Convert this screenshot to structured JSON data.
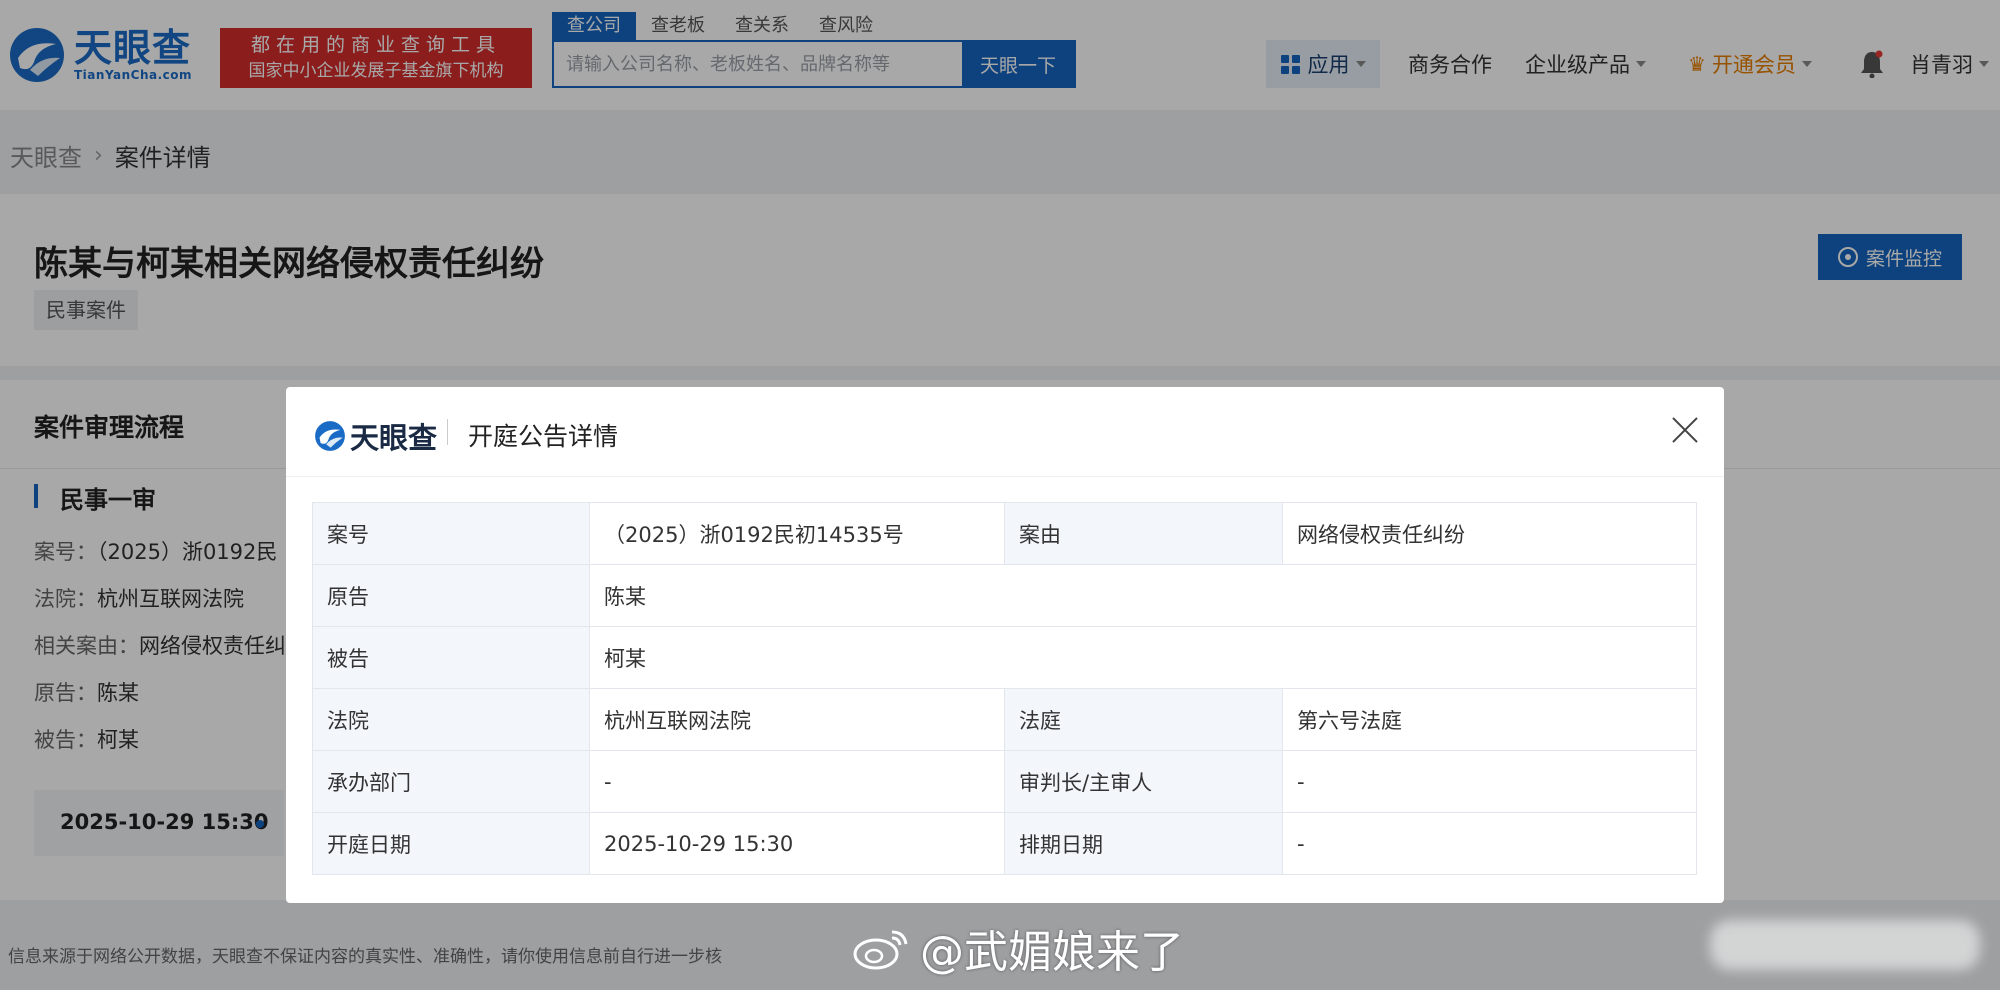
{
  "header": {
    "logo_cn": "天眼查",
    "logo_en": "TianYanCha.com",
    "slogan_line1": "都在用的商业查询工具",
    "slogan_line2": "国家中小企业发展子基金旗下机构",
    "search_tabs": [
      "查公司",
      "查老板",
      "查关系",
      "查风险"
    ],
    "search_placeholder": "请输入公司名称、老板姓名、品牌名称等",
    "search_button": "天眼一下",
    "nav": {
      "apps": "应用",
      "business": "商务合作",
      "enterprise": "企业级产品",
      "vip": "开通会员",
      "user": "肖青羽"
    }
  },
  "breadcrumb": {
    "home": "天眼查",
    "current": "案件详情"
  },
  "case": {
    "title": "陈某与柯某相关网络侵权责任纠纷",
    "tag": "民事案件",
    "monitor_button": "案件监控"
  },
  "process": {
    "title": "案件审理流程",
    "stage": "民事一审",
    "lines": [
      {
        "key": "案号：",
        "value": "（2025）浙0192民"
      },
      {
        "key": "法院：",
        "value": "杭州互联网法院"
      },
      {
        "key": "相关案由：",
        "value": "网络侵权责任纠"
      },
      {
        "key": "原告：",
        "value": "陈某"
      },
      {
        "key": "被告：",
        "value": "柯某"
      }
    ],
    "timeline_date": "2025-10-29 15:30"
  },
  "footer_note": "信息来源于网络公开数据，天眼查不保证内容的真实性、准确性，请你使用信息前自行进一步核",
  "modal": {
    "logo_cn": "天眼查",
    "title": "开庭公告详情",
    "rows": [
      {
        "l1": "案号",
        "v1": "（2025）浙0192民初14535号",
        "l2": "案由",
        "v2": "网络侵权责任纠纷"
      },
      {
        "l1": "原告",
        "v1": "陈某"
      },
      {
        "l1": "被告",
        "v1": "柯某"
      },
      {
        "l1": "法院",
        "v1": "杭州互联网法院",
        "l2": "法庭",
        "v2": "第六号法庭"
      },
      {
        "l1": "承办部门",
        "v1": "-",
        "l2": "审判长/主审人",
        "v2": "-"
      },
      {
        "l1": "开庭日期",
        "v1": "2025-10-29 15:30",
        "l2": "排期日期",
        "v2": "-"
      }
    ]
  },
  "watermark": "@武媚娘来了",
  "colors": {
    "brand_blue": "#1565c0",
    "slogan_red": "#d42d2d",
    "vip_orange": "#e67e00"
  }
}
